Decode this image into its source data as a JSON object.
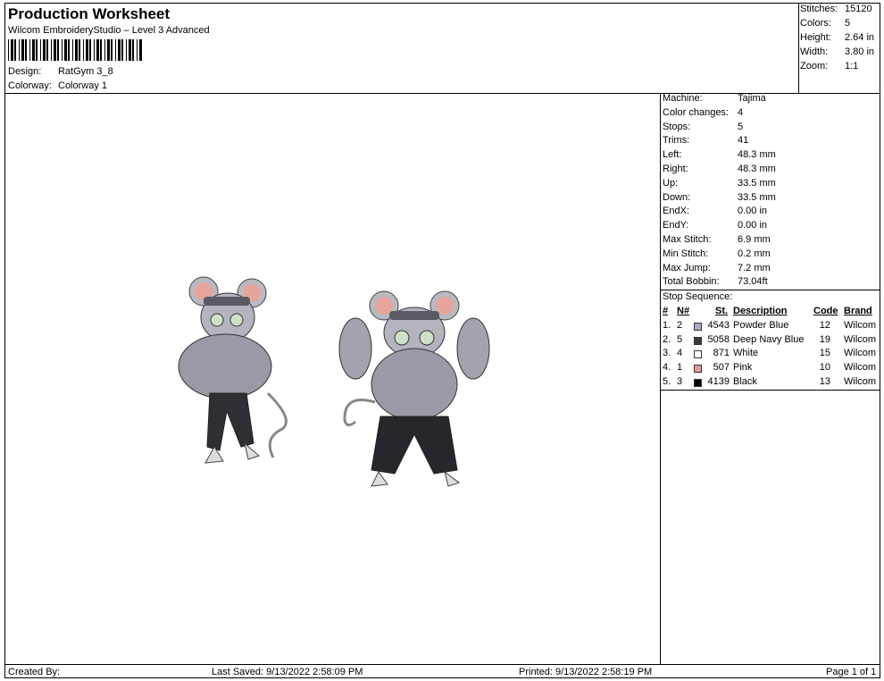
{
  "header": {
    "title": "Production Worksheet",
    "subtitle": "Wilcom EmbroideryStudio – Level 3 Advanced",
    "design_label": "Design:",
    "design_value": "RatGym 3_8",
    "colorway_label": "Colorway:",
    "colorway_value": "Colorway 1"
  },
  "summary": [
    {
      "k": "Stitches:",
      "v": "15120"
    },
    {
      "k": "Colors:",
      "v": "5"
    },
    {
      "k": "Height:",
      "v": "2.64 in"
    },
    {
      "k": "Width:",
      "v": "3.80 in"
    },
    {
      "k": "Zoom:",
      "v": "1:1"
    }
  ],
  "stats": [
    {
      "k": "Machine:",
      "v": "Tajima"
    },
    {
      "k": "Color changes:",
      "v": "4"
    },
    {
      "k": "Stops:",
      "v": "5"
    },
    {
      "k": "Trims:",
      "v": "41"
    },
    {
      "k": "Left:",
      "v": "48.3 mm"
    },
    {
      "k": "Right:",
      "v": "48.3 mm"
    },
    {
      "k": "Up:",
      "v": "33.5 mm"
    },
    {
      "k": "Down:",
      "v": "33.5 mm"
    },
    {
      "k": "EndX:",
      "v": "0.00 in"
    },
    {
      "k": "EndY:",
      "v": "0.00 in"
    },
    {
      "k": "Max Stitch:",
      "v": "6.9 mm"
    },
    {
      "k": "Min Stitch:",
      "v": "0.2 mm"
    },
    {
      "k": "Max Jump:",
      "v": "7.2 mm"
    },
    {
      "k": "Total Bobbin:",
      "v": "73.04ft"
    }
  ],
  "stop_sequence": {
    "label": "Stop Sequence:",
    "headers": {
      "num": "#",
      "n": "N#",
      "st": "St.",
      "desc": "Description",
      "code": "Code",
      "brand": "Brand"
    },
    "rows": [
      {
        "num": "1.",
        "n": "2",
        "color": "#a9a9c9",
        "st": "4543",
        "desc": "Powder Blue",
        "code": "12",
        "brand": "Wilcom"
      },
      {
        "num": "2.",
        "n": "5",
        "color": "#3a3a42",
        "st": "5058",
        "desc": "Deep Navy Blue",
        "code": "19",
        "brand": "Wilcom"
      },
      {
        "num": "3.",
        "n": "4",
        "color": "#ffffff",
        "st": "871",
        "desc": "White",
        "code": "15",
        "brand": "Wilcom"
      },
      {
        "num": "4.",
        "n": "1",
        "color": "#e89a9a",
        "st": "507",
        "desc": "Pink",
        "code": "10",
        "brand": "Wilcom"
      },
      {
        "num": "5.",
        "n": "3",
        "color": "#000000",
        "st": "4139",
        "desc": "Black",
        "code": "13",
        "brand": "Wilcom"
      }
    ]
  },
  "footer": {
    "created_by": "Created By:",
    "last_saved": "Last Saved: 9/13/2022 2:58:09 PM",
    "printed": "Printed: 9/13/2022 2:58:19 PM",
    "page": "Page 1 of 1"
  }
}
